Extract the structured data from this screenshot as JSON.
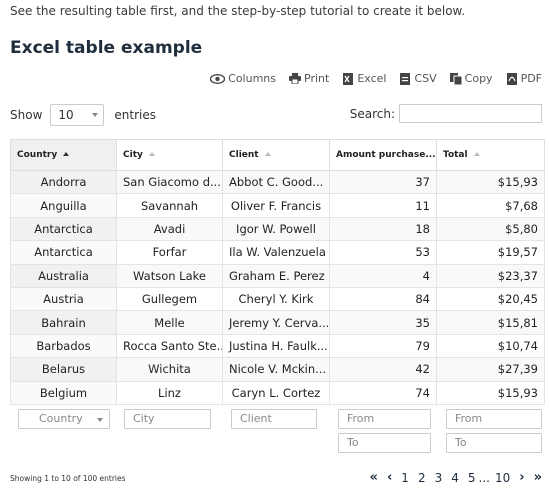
{
  "intro_text": "See the resulting table first, and the step-by-step tutorial to create it below.",
  "title": "Excel table example",
  "toolbar": {
    "columns": "Columns",
    "print": "Print",
    "excel": "Excel",
    "csv": "CSV",
    "copy": "Copy",
    "pdf": "PDF"
  },
  "length": {
    "show": "Show",
    "value": "10",
    "entries": "entries"
  },
  "search": {
    "label": "Search:",
    "value": ""
  },
  "columns": [
    "Country",
    "City",
    "Client",
    "Amount purchase...",
    "Total"
  ],
  "rows": [
    [
      "Andorra",
      "San Giacomo d...",
      "Abbot C. Good...",
      "37",
      "$15,93"
    ],
    [
      "Anguilla",
      "Savannah",
      "Oliver F. Francis",
      "11",
      "$7,68"
    ],
    [
      "Antarctica",
      "Avadi",
      "Igor W. Powell",
      "18",
      "$5,80"
    ],
    [
      "Antarctica",
      "Forfar",
      "Ila W. Valenzuela",
      "53",
      "$19,57"
    ],
    [
      "Australia",
      "Watson Lake",
      "Graham E. Perez",
      "4",
      "$23,37"
    ],
    [
      "Austria",
      "Gullegem",
      "Cheryl Y. Kirk",
      "84",
      "$20,45"
    ],
    [
      "Bahrain",
      "Melle",
      "Jeremy Y. Cerva...",
      "35",
      "$15,81"
    ],
    [
      "Barbados",
      "Rocca Santo Ste...",
      "Justina H. Faulk...",
      "79",
      "$10,74"
    ],
    [
      "Belarus",
      "Wichita",
      "Nicole V. Mckin...",
      "42",
      "$27,39"
    ],
    [
      "Belgium",
      "Linz",
      "Caryn L. Cortez",
      "74",
      "$15,93"
    ]
  ],
  "filters": {
    "country": "Country",
    "city": "City",
    "client": "Client",
    "amount_from": "From",
    "amount_to": "To",
    "total_from": "From",
    "total_to": "To"
  },
  "footer_info": "Showing 1 to 10 of 100 entries",
  "pagination": {
    "first": "«",
    "prev": "‹",
    "pages": [
      "1",
      "2",
      "3",
      "4",
      "5"
    ],
    "ellipsis": "...",
    "last_page": "10",
    "next": "›",
    "last": "»"
  }
}
